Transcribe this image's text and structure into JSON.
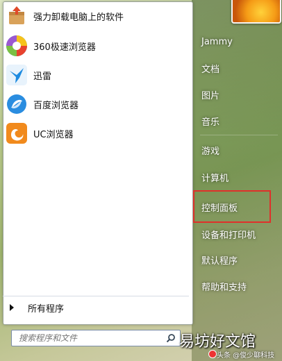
{
  "programs": [
    {
      "label": "强力卸载电脑上的软件",
      "icon": "uninstall-box-icon"
    },
    {
      "label": "360极速浏览器",
      "icon": "360-browser-icon"
    },
    {
      "label": "迅雷",
      "icon": "xunlei-bird-icon"
    },
    {
      "label": "百度浏览器",
      "icon": "baidu-browser-icon"
    },
    {
      "label": "UC浏览器",
      "icon": "uc-browser-icon"
    }
  ],
  "all_programs": "所有程序",
  "search": {
    "placeholder": "搜索程序和文件"
  },
  "right_menu": {
    "user": "Jammy",
    "documents": "文档",
    "pictures": "图片",
    "music": "音乐",
    "games": "游戏",
    "computer": "计算机",
    "control_panel": "控制面板",
    "devices": "设备和打印机",
    "default_programs": "默认程序",
    "help": "帮助和支持"
  },
  "watermark": {
    "title": "易坊好文馆",
    "source": "头条 @俊少聊科技"
  },
  "colors": {
    "highlight_box": "#e0302a"
  }
}
